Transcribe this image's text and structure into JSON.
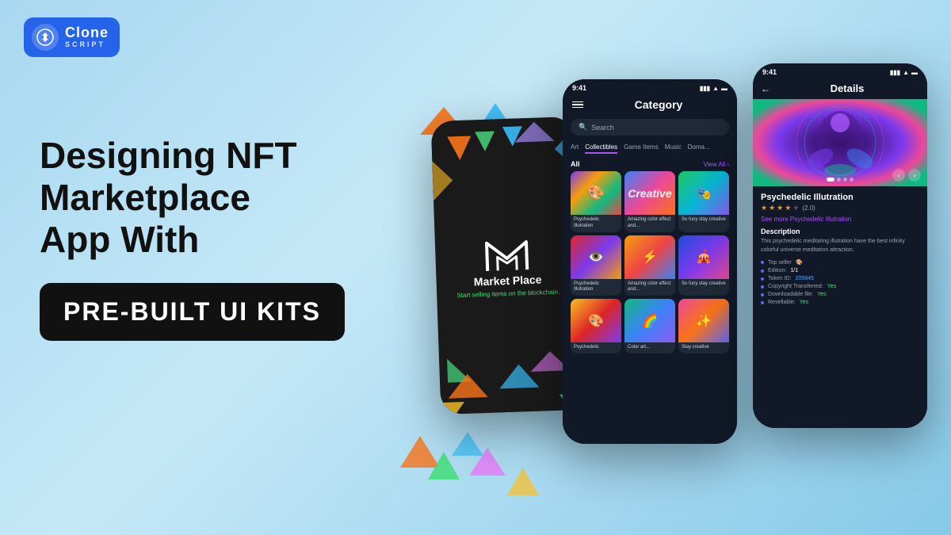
{
  "logo": {
    "brand": "Clone",
    "sub": "SCRIPT",
    "icon": "©"
  },
  "heading": {
    "line1": "Designing NFT",
    "line2": "Marketplace",
    "line3": "App With",
    "highlight": "PRE-BUILT UI KITS"
  },
  "phone1": {
    "title": "Market Place",
    "subtitle": "Start selling items on the blockchain."
  },
  "phone2": {
    "time": "9:41",
    "title": "Category",
    "search_placeholder": "Search",
    "tabs": [
      "Art",
      "Collectibles",
      "Game Items",
      "Music",
      "Doma..."
    ],
    "section_all": "All",
    "view_all": "View All",
    "nfts": [
      {
        "label": "Psychedelic Illutration",
        "art": "psychedelic"
      },
      {
        "label": "Amazing color effect and...",
        "art": "creative"
      },
      {
        "label": "So funy stay creative",
        "art": "creative2"
      },
      {
        "label": "Psychedelic Illutration",
        "art": "psychedelic2"
      },
      {
        "label": "Amazing color effect and...",
        "art": "amazing"
      },
      {
        "label": "So funy stay creative",
        "art": "stay"
      }
    ]
  },
  "phone3": {
    "time": "9:41",
    "title": "Details",
    "nft_name": "Psychedelic Illutration",
    "rating": 4,
    "rating_count": "(2.0)",
    "see_more": "See more Psychedelic Illutration",
    "description_label": "Description",
    "description": "This psychedelic meditating illutration have the best infinity colorful universe meditation attraction.",
    "details": [
      {
        "key": "Top seller",
        "val": "🎨",
        "type": "icon"
      },
      {
        "key": "Edition:",
        "val": "1/1",
        "type": "normal"
      },
      {
        "key": "Token ID:",
        "val": "205845",
        "type": "link"
      },
      {
        "key": "Copyright Transferred:",
        "val": "Yes",
        "type": "yes"
      },
      {
        "key": "Downloadable file:",
        "val": "Yes",
        "type": "yes"
      },
      {
        "key": "Resellable:",
        "val": "Yes",
        "type": "yes"
      }
    ]
  }
}
